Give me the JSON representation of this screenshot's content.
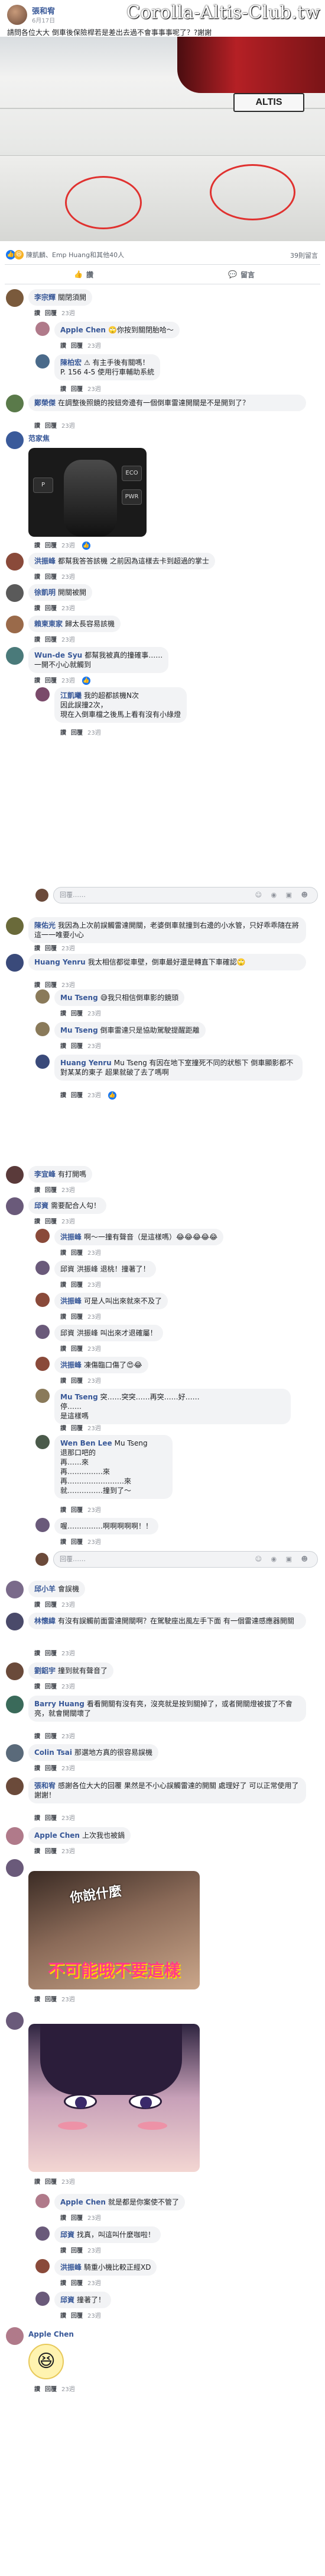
{
  "post": {
    "author": "張和宥",
    "date": "6月17日",
    "text": "請問各位大大 倒車後保險桿若是差出去過不會事事事呢了？?謝謝",
    "watermark": "Corolla-Altis-Club.tw",
    "plate_text": "ALTIS",
    "reactions_text": "陳凱麟、Emp Huang和其他40人",
    "comment_count": "39則留言",
    "like_label": "讚",
    "comment_label": "留言"
  },
  "colors": {
    "link": "#385898",
    "like_blue": "#1877f2",
    "haha_yellow": "#f7b125",
    "bubble_bg": "#f2f3f5",
    "circle_red": "#e0312f"
  },
  "reply_placeholder": "回覆……",
  "meta": {
    "like": "讚",
    "reply": "回覆",
    "time": "23週"
  },
  "comments": [
    {
      "name": "李宗輝",
      "text": "關閉須開",
      "reply": false,
      "avatar": "#7a5a3c"
    },
    {
      "name": "Apple Chen",
      "text": "🙄你按到關閉胎哈～",
      "reply": true,
      "avatar": "#b07a8a"
    },
    {
      "name": "陳柏宏",
      "text": "⚠ 有主手後有關嗎！\nP. 156 4-5 使用行車輔助系統",
      "reply": true,
      "avatar": "#4a6a8a"
    },
    {
      "name": "鄭榮傑",
      "text": "在調整後照鏡的按鈕旁邊有一個倒車雷達開關是不是開到了？",
      "reply": false,
      "avatar": "#5a7a4a"
    },
    {
      "name": "范家焦",
      "text": "",
      "reply": false,
      "avatar": "#3a5a9a"
    },
    {
      "name": "洪振峰",
      "text": "都幫我答答該機 之前因為這樣去卡到超過的掌士",
      "reply": false,
      "avatar": "#8a4a3a"
    },
    {
      "name": "徐凱明",
      "text": "開關被開",
      "reply": false,
      "avatar": "#5a5a5a"
    },
    {
      "name": "賴柬東家",
      "text": "歸太長容易該機",
      "reply": false,
      "avatar": "#9a6a4a"
    },
    {
      "name": "Wun-de Syu",
      "text": "都幫我被真的撞確事……\n一開不小心就觸到",
      "reply": false,
      "avatar": "#4a7a7a"
    },
    {
      "name": "江凱曦",
      "text": "我的超都該機N次\n因此誤撞2次，\n現在入倒車檔之後馬上看有沒有小綠燈",
      "reply": true,
      "avatar": "#7a4a6a"
    },
    {
      "name": "陳佑光",
      "text": "我因為上次前誤觸雷達開關，老婆倒車就撞到右邊的小水管，只好乖乖隨在將這一一唯要小心",
      "reply": false,
      "avatar": "#6a6a3a"
    },
    {
      "name": "Huang Yenru",
      "text": "我太相信都從車壁，倒車最好還是轉直下車確認🙄",
      "reply": false,
      "avatar": "#3a4a7a"
    },
    {
      "name": "Mu Tseng",
      "text": "😅我只相信倒車影的鏡頭",
      "reply": true,
      "avatar": "#8a7a5a"
    },
    {
      "name": "Mu Tseng",
      "text": "倒車雷達只是協助駕駛提醒距離",
      "reply": true,
      "avatar": "#8a7a5a"
    },
    {
      "name": "Huang Yenru",
      "text": "Mu Tseng 有因在地下室撞死不同的狀態下 倒車顯影都不對某某的東子 超果就破了去了嗎啊",
      "reply": true,
      "avatar": "#3a4a7a"
    },
    {
      "name": "李宜峰",
      "text": "有打開嗎",
      "reply": false,
      "avatar": "#5a3a3a"
    },
    {
      "name": "邱資",
      "text": "需要配合人勾！",
      "reply": false,
      "avatar": "#6a5a7a"
    },
    {
      "name": "洪振峰",
      "text": "啊～一撞有聲音（是這樣嗎）😂😂😂😂😂",
      "reply": true,
      "avatar": "#8a4a3a"
    },
    {
      "name": "邱資",
      "text": "邱資 洪振峰 退桃！撞著了！",
      "reply": true,
      "avatar": "#6a5a7a"
    },
    {
      "name": "洪振峰",
      "text": "可是人叫出來就來不及了",
      "reply": true,
      "avatar": "#8a4a3a"
    },
    {
      "name": "邱資",
      "text": "邱資 洪振峰 叫出來才退確屬！",
      "reply": true,
      "avatar": "#6a5a7a"
    },
    {
      "name": "洪振峰",
      "text": "凍傷臨口傷了😍😂",
      "reply": true,
      "avatar": "#8a4a3a"
    },
    {
      "name": "Mu Tseng",
      "text": "突……突突……再突……好……\n停……\n是這樣嗎",
      "reply": true,
      "avatar": "#8a7a5a"
    },
    {
      "name": "Wen Ben Lee",
      "text": "Mu Tseng\n退那口吧的\n再……來\n再……………來\n再……………………來\n就……………撞到了～",
      "reply": true,
      "avatar": "#4a5a4a"
    },
    {
      "name": "邱資",
      "text": "喔……………啊啊啊啊啊！！",
      "reply": true,
      "avatar": "#6a5a7a"
    },
    {
      "name": "邱小羊",
      "text": "會誤機",
      "reply": false,
      "avatar": "#7a6a8a"
    },
    {
      "name": "林懷緯",
      "text": "有沒有誤觸前面雷達開關啊？在駕駛座出風左手下面 有一個雷達感應器開關",
      "reply": false,
      "avatar": "#4a4a6a"
    },
    {
      "name": "劉鋁宇",
      "text": "撞到就有聲音了",
      "reply": false,
      "avatar": "#6a4a3a"
    },
    {
      "name": "Barry Huang",
      "text": "看看開關有沒有亮，沒亮就是按到關掉了，或者開關燈被拔了不會亮，就會開關壞了",
      "reply": false,
      "avatar": "#3a6a5a"
    },
    {
      "name": "Colin Tsai",
      "text": "那選地方真的很容易誤機",
      "reply": false,
      "avatar": "#5a6a7a"
    },
    {
      "name": "張和宥",
      "text": "感謝各位大大的回覆 果然是不小心誤觸雷達的開關 處理好了 可以正常使用了 謝謝！",
      "reply": false,
      "avatar": "#6b4a3a"
    },
    {
      "name": "Apple Chen",
      "text": "上次我也被鍋",
      "reply": false,
      "avatar": "#b07a8a"
    },
    {
      "name": "邱資",
      "text": "",
      "reply": false,
      "avatar": "#6a5a7a"
    },
    {
      "name": "邱資",
      "text": "",
      "reply": false,
      "avatar": "#6a5a7a"
    },
    {
      "name": "Apple Chen",
      "text": "就是都是你案使不管了",
      "reply": true,
      "avatar": "#b07a8a"
    },
    {
      "name": "邱資",
      "text": "找真，叫這叫什麼咖啦！",
      "reply": true,
      "avatar": "#6a5a7a"
    },
    {
      "name": "洪振峰",
      "text": "騎重小機比較正經XD",
      "reply": true,
      "avatar": "#8a4a3a"
    },
    {
      "name": "邱資",
      "text": "撞著了！",
      "reply": true,
      "avatar": "#6a5a7a"
    },
    {
      "name": "Apple Chen",
      "text": "",
      "reply": false,
      "avatar": "#b07a8a"
    }
  ],
  "images": {
    "gear": {
      "buttons": [
        "P",
        "ECO",
        "PWR"
      ]
    },
    "meme": {
      "top_text": "你說什麼",
      "caption": "不可能哦不要這樣"
    },
    "sticker": "😆"
  }
}
